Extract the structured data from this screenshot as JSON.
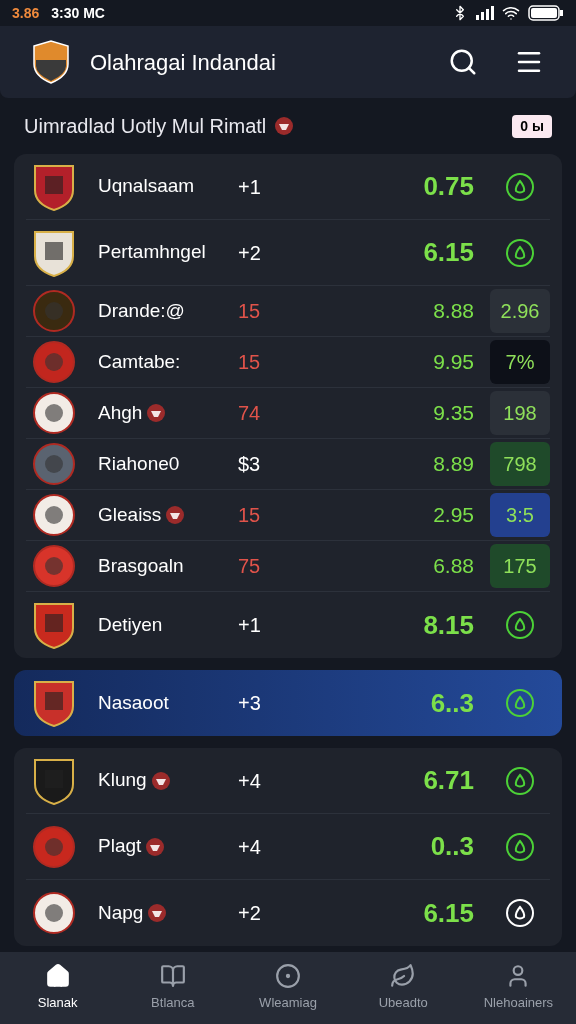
{
  "status_bar": {
    "time": "3.86",
    "carrier": "3:30 MC"
  },
  "header": {
    "title": "Olahragai Indandai"
  },
  "subheader": {
    "title": "Uimradlad Uotly Mul Rimatl",
    "badge": "0 ы"
  },
  "groups": [
    {
      "highlighted": false,
      "rows": [
        {
          "name": "Uqnalsaam",
          "emblem": false,
          "crest": {
            "kind": "shield",
            "color": "#b3202a"
          },
          "rank": {
            "text": "+1",
            "color": "#ffffff"
          },
          "score": "0.75",
          "badge": {
            "kind": "icon",
            "color": "#4cd137"
          }
        },
        {
          "name": "Pertamhngel",
          "emblem": false,
          "crest": {
            "kind": "shield",
            "color": "#e8e2d8"
          },
          "rank": {
            "text": "+2",
            "color": "#ffffff"
          },
          "score": "6.15",
          "badge": {
            "kind": "icon",
            "color": "#4cd137"
          }
        },
        {
          "name": "Drande:@",
          "emblem": false,
          "crest": {
            "kind": "round",
            "color": "#3a2a10"
          },
          "rank": {
            "text": "15",
            "color": "#e0534a"
          },
          "score": "8.88",
          "badge": {
            "kind": "box",
            "text": "2.96",
            "color": "#2b3038"
          }
        },
        {
          "name": "Camtabe:",
          "emblem": false,
          "crest": {
            "kind": "round",
            "color": "#c2261e"
          },
          "rank": {
            "text": "15",
            "color": "#e0534a"
          },
          "score": "9.95",
          "badge": {
            "kind": "box",
            "text": "7%",
            "color": "#0d1018"
          }
        },
        {
          "name": "Ahgh",
          "emblem": true,
          "crest": {
            "kind": "round",
            "color": "#f2ece6"
          },
          "rank": {
            "text": "74",
            "color": "#e0534a"
          },
          "score": "9.35",
          "badge": {
            "kind": "box",
            "text": "198",
            "color": "#2b3038"
          }
        },
        {
          "name": "Riahone0",
          "emblem": false,
          "crest": {
            "kind": "round",
            "color": "#5a6370"
          },
          "rank": {
            "text": "$3",
            "color": "#ffffff"
          },
          "score": "8.89",
          "badge": {
            "kind": "box",
            "text": "798",
            "color": "#1f4a2a"
          }
        },
        {
          "name": "Gleaiss",
          "emblem": true,
          "crest": {
            "kind": "round",
            "color": "#f2ece6"
          },
          "rank": {
            "text": "15",
            "color": "#e0534a"
          },
          "score": "2.95",
          "badge": {
            "kind": "box",
            "text": "3:5",
            "color": "#23408f"
          }
        },
        {
          "name": "Brasgoaln",
          "emblem": false,
          "crest": {
            "kind": "round",
            "color": "#d8342a"
          },
          "rank": {
            "text": "75",
            "color": "#e0534a"
          },
          "score": "6.88",
          "badge": {
            "kind": "box",
            "text": "175",
            "color": "#1f4a2a"
          }
        },
        {
          "name": "Detiyen",
          "emblem": false,
          "crest": {
            "kind": "shield",
            "color": "#c82a1e"
          },
          "rank": {
            "text": "+1",
            "color": "#ffffff"
          },
          "score": "8.15",
          "badge": {
            "kind": "icon",
            "color": "#4cd137"
          }
        }
      ]
    },
    {
      "highlighted": true,
      "rows": [
        {
          "name": "Nasaoot",
          "emblem": false,
          "crest": {
            "kind": "shield",
            "color": "#c8302a"
          },
          "rank": {
            "text": "+3",
            "color": "#ffffff"
          },
          "score": "6..3",
          "badge": {
            "kind": "icon",
            "color": "#4cd137"
          }
        }
      ]
    },
    {
      "highlighted": false,
      "rows": [
        {
          "name": "Klung",
          "emblem": true,
          "crest": {
            "kind": "shield",
            "color": "#1a1a1a"
          },
          "rank": {
            "text": "+4",
            "color": "#ffffff"
          },
          "score": "6.71",
          "badge": {
            "kind": "icon",
            "color": "#4cd137"
          }
        },
        {
          "name": "Plagt",
          "emblem": true,
          "crest": {
            "kind": "round",
            "color": "#c8281e"
          },
          "rank": {
            "text": "+4",
            "color": "#ffffff"
          },
          "score": "0..3",
          "badge": {
            "kind": "icon",
            "color": "#4cd137"
          }
        },
        {
          "name": "Napg",
          "emblem": true,
          "crest": {
            "kind": "round",
            "color": "#f2ece6"
          },
          "rank": {
            "text": "+2",
            "color": "#ffffff"
          },
          "score": "6.15",
          "badge": {
            "kind": "icon",
            "color": "#ffffff"
          }
        }
      ]
    }
  ],
  "nav": [
    {
      "label": "Slanak",
      "kind": "home",
      "selected": true
    },
    {
      "label": "Btlanca",
      "kind": "book",
      "selected": false
    },
    {
      "label": "Wleamiag",
      "kind": "record",
      "selected": false
    },
    {
      "label": "Ubeadto",
      "kind": "leaf",
      "selected": false
    },
    {
      "label": "Nlehoainers",
      "kind": "person",
      "selected": false
    }
  ]
}
